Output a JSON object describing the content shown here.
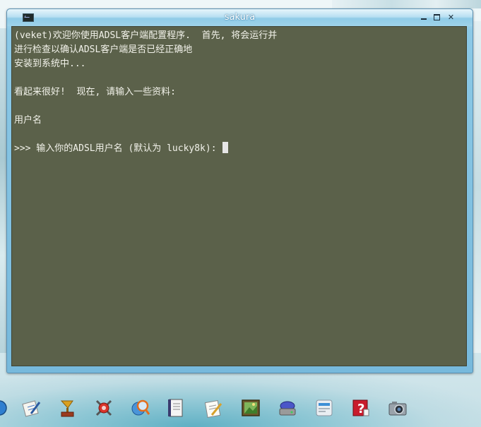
{
  "window": {
    "title": "sakura",
    "minimize_label": "minimize",
    "maximize_label": "maximize",
    "close_label": "✕"
  },
  "terminal": {
    "lines": [
      "(veket)欢迎你使用ADSL客户端配置程序.  首先, 将会运行并",
      "进行检查以确认ADSL客户端是否已经正确地",
      "安装到系统中...",
      "",
      "看起来很好!  现在, 请输入一些资料:",
      "",
      "用户名",
      "",
      ">>> 输入你的ADSL用户名 (默认为 lucky8k): "
    ]
  },
  "dock": {
    "items": [
      {
        "icon": "partial-app-icon"
      },
      {
        "icon": "notepad-pen-icon"
      },
      {
        "icon": "gramophone-icon"
      },
      {
        "icon": "network-tool-icon"
      },
      {
        "icon": "search-globe-icon"
      },
      {
        "icon": "document-viewer-icon"
      },
      {
        "icon": "text-editor-icon"
      },
      {
        "icon": "image-viewer-icon"
      },
      {
        "icon": "disk-drive-icon"
      },
      {
        "icon": "keyboard-settings-icon"
      },
      {
        "icon": "help-icon"
      },
      {
        "icon": "camera-icon"
      }
    ]
  },
  "colors": {
    "terminal_bg": "#5b614a",
    "terminal_text": "#f2f2ea",
    "titlebar": "#9fd3ea"
  }
}
